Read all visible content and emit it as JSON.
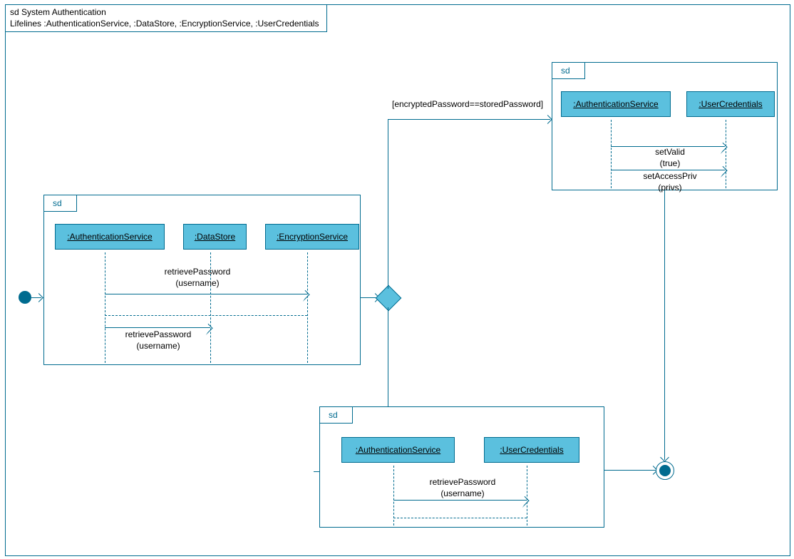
{
  "outer": {
    "title": "sd System Authentication",
    "lifelines_line": "Lifelines :AuthenticationService, :DataStore, :EncryptionService, :UserCredentials"
  },
  "sd1": {
    "tab": "sd",
    "lifeline1": ":AuthenticationService",
    "lifeline2": ":DataStore",
    "lifeline3": ":EncryptionService",
    "msg1": "retrievePassword",
    "msg1_arg": "(username)",
    "msg2": "retrievePassword",
    "msg2_arg": "(username)"
  },
  "sd2": {
    "tab": "sd",
    "lifeline1": ":AuthenticationService",
    "lifeline2": ":UserCredentials",
    "msg1": "setValid",
    "msg1_arg": "(true)",
    "msg2": "setAccessPriv",
    "msg2_arg": "(privs)"
  },
  "sd3": {
    "tab": "sd",
    "lifeline1": ":AuthenticationService",
    "lifeline2": ":UserCredentials",
    "msg1": "retrievePassword",
    "msg1_arg": "(username)"
  },
  "guard": "[encryptedPassword==storedPassword]"
}
